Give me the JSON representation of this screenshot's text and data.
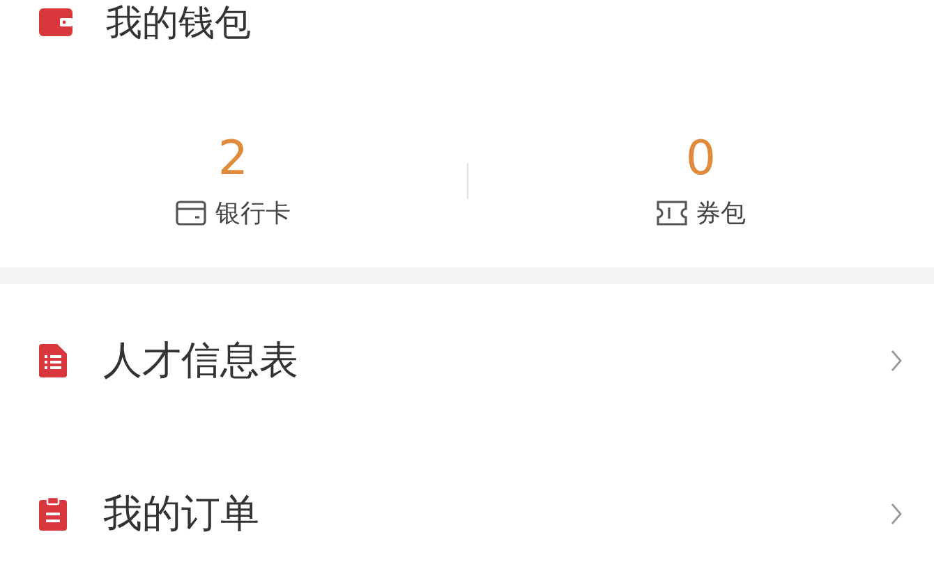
{
  "wallet": {
    "title": "我的钱包",
    "stats": [
      {
        "kind": "card",
        "value": "2",
        "label": "银行卡"
      },
      {
        "kind": "coupon",
        "value": "0",
        "label": "券包"
      }
    ]
  },
  "menu": [
    {
      "kind": "form",
      "label": "人才信息表"
    },
    {
      "kind": "clipboard",
      "label": "我的订单"
    }
  ]
}
